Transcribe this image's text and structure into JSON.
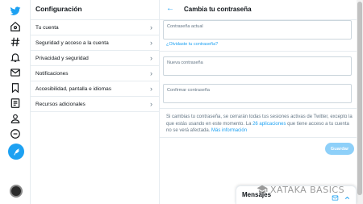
{
  "nav": {
    "icons": [
      "twitter-logo",
      "home",
      "explore-hashtag",
      "notifications-bell",
      "messages-envelope",
      "bookmarks",
      "lists",
      "profile",
      "more"
    ],
    "accent": "#1da1f2"
  },
  "settings": {
    "title": "Configuración",
    "items": [
      {
        "label": "Tu cuenta"
      },
      {
        "label": "Seguridad y acceso a la cuenta"
      },
      {
        "label": "Privacidad y seguridad"
      },
      {
        "label": "Notificaciones"
      },
      {
        "label": "Accesibilidad, pantalla e idiomas"
      },
      {
        "label": "Recursos adicionales"
      }
    ]
  },
  "password": {
    "title": "Cambia tu contraseña",
    "current_label": "Contraseña actual",
    "forgot_link": "¿Olvidaste tu contraseña?",
    "new_label": "Nueva contraseña",
    "confirm_label": "Confirmar contraseña",
    "info_part1": "Si cambias tu contraseña, se cerrarán todas tus sesiones activas de Twitter, excepto la que estás usando en este momento. La ",
    "info_link": "26 aplicaciones",
    "info_part2": " que tiene acceso a tu cuenta no se verá afectada. ",
    "more_info": "Más información",
    "save_label": "Guardar"
  },
  "messages": {
    "label": "Mensajes"
  },
  "watermark": {
    "text": "XATAKA BASICS"
  }
}
